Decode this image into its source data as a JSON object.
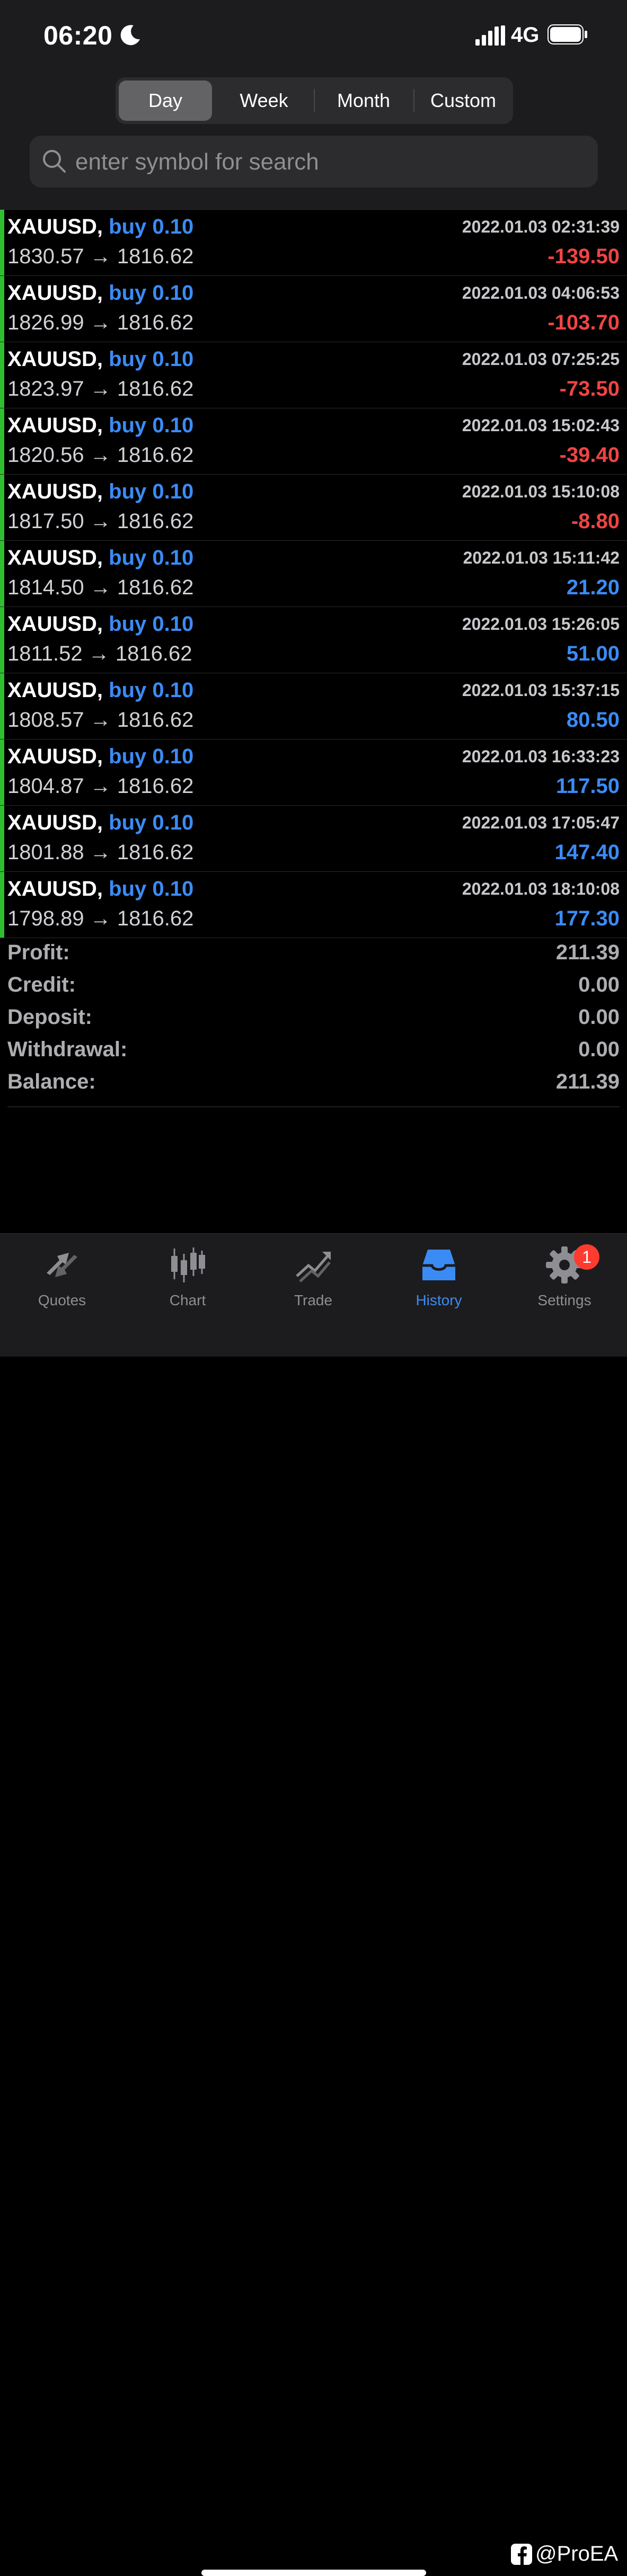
{
  "status_bar": {
    "time": "06:20",
    "network": "4G"
  },
  "segments": [
    {
      "label": "Day",
      "active": true
    },
    {
      "label": "Week",
      "active": false
    },
    {
      "label": "Month",
      "active": false
    },
    {
      "label": "Custom",
      "active": false
    }
  ],
  "search": {
    "placeholder": "enter symbol for search",
    "value": ""
  },
  "deals": [
    {
      "symbol": "XAUUSD,",
      "type": "buy 0.10",
      "prices": "1830.57 → 1816.62",
      "time": "2022.01.03 02:31:39",
      "profit": "-139.50"
    },
    {
      "symbol": "XAUUSD,",
      "type": "buy 0.10",
      "prices": "1826.99 → 1816.62",
      "time": "2022.01.03 04:06:53",
      "profit": "-103.70"
    },
    {
      "symbol": "XAUUSD,",
      "type": "buy 0.10",
      "prices": "1823.97 → 1816.62",
      "time": "2022.01.03 07:25:25",
      "profit": "-73.50"
    },
    {
      "symbol": "XAUUSD,",
      "type": "buy 0.10",
      "prices": "1820.56 → 1816.62",
      "time": "2022.01.03 15:02:43",
      "profit": "-39.40"
    },
    {
      "symbol": "XAUUSD,",
      "type": "buy 0.10",
      "prices": "1817.50 → 1816.62",
      "time": "2022.01.03 15:10:08",
      "profit": "-8.80"
    },
    {
      "symbol": "XAUUSD,",
      "type": "buy 0.10",
      "prices": "1814.50 → 1816.62",
      "time": "2022.01.03 15:11:42",
      "profit": "21.20"
    },
    {
      "symbol": "XAUUSD,",
      "type": "buy 0.10",
      "prices": "1811.52 → 1816.62",
      "time": "2022.01.03 15:26:05",
      "profit": "51.00"
    },
    {
      "symbol": "XAUUSD,",
      "type": "buy 0.10",
      "prices": "1808.57 → 1816.62",
      "time": "2022.01.03 15:37:15",
      "profit": "80.50"
    },
    {
      "symbol": "XAUUSD,",
      "type": "buy 0.10",
      "prices": "1804.87 → 1816.62",
      "time": "2022.01.03 16:33:23",
      "profit": "117.50"
    },
    {
      "symbol": "XAUUSD,",
      "type": "buy 0.10",
      "prices": "1801.88 → 1816.62",
      "time": "2022.01.03 17:05:47",
      "profit": "147.40"
    },
    {
      "symbol": "XAUUSD,",
      "type": "buy 0.10",
      "prices": "1798.89 → 1816.62",
      "time": "2022.01.03 18:10:08",
      "profit": "177.30"
    }
  ],
  "summary": [
    {
      "label": "Profit:",
      "value": "211.39"
    },
    {
      "label": "Credit:",
      "value": "0.00"
    },
    {
      "label": "Deposit:",
      "value": "0.00"
    },
    {
      "label": "Withdrawal:",
      "value": "0.00"
    },
    {
      "label": "Balance:",
      "value": "211.39"
    }
  ],
  "tabs": [
    {
      "label": "Quotes",
      "icon": "quotes-icon",
      "active": false
    },
    {
      "label": "Chart",
      "icon": "chart-icon",
      "active": false
    },
    {
      "label": "Trade",
      "icon": "trade-icon",
      "active": false
    },
    {
      "label": "History",
      "icon": "history-icon",
      "active": true
    },
    {
      "label": "Settings",
      "icon": "gear-icon",
      "active": false,
      "badge": "1"
    }
  ],
  "watermark": "@ProEA",
  "colors": {
    "accent": "#3b8bf5",
    "loss": "#ef4444",
    "deal_bar": "#2fbf2f",
    "badge": "#ff3b30"
  }
}
